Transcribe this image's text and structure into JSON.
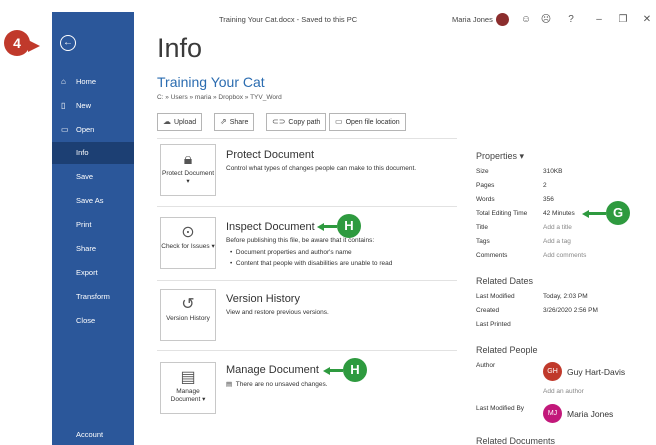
{
  "sidebar": {
    "back_icon": "back-arrow-icon",
    "items": [
      {
        "label": "Home",
        "icon": "home-icon"
      },
      {
        "label": "New",
        "icon": "new-doc-icon"
      },
      {
        "label": "Open",
        "icon": "folder-icon"
      },
      {
        "label": "Info"
      },
      {
        "label": "Save"
      },
      {
        "label": "Save As"
      },
      {
        "label": "Print"
      },
      {
        "label": "Share"
      },
      {
        "label": "Export"
      },
      {
        "label": "Transform"
      },
      {
        "label": "Close"
      },
      {
        "label": "Account"
      }
    ]
  },
  "titlebar": {
    "document": "Training Your Cat.docx  -  Saved to this PC",
    "user": "Maria Jones",
    "icons": {
      "smile": "☺",
      "frown": "☹",
      "help": "?",
      "minimize": "–",
      "restore": "❐",
      "close": "✕"
    }
  },
  "main": {
    "heading": "Info",
    "doc_name": "Training Your Cat",
    "doc_path": "C: » Users » maria » Dropbox » TYV_Word",
    "buttons": [
      "Upload",
      "Share",
      "Copy path",
      "Open file location"
    ],
    "cards": [
      {
        "tile": "Protect Document",
        "title": "Protect Document",
        "desc": "Control what types of changes people can make to this document."
      },
      {
        "tile": "Check for Issues",
        "title": "Inspect Document",
        "desc": "Before publishing this file, be aware that it contains:",
        "bullets": [
          "Document properties and author's name",
          "Content that people with disabilities are unable to read"
        ]
      },
      {
        "tile": "Version History",
        "title": "Version History",
        "desc": "View and restore previous versions."
      },
      {
        "tile": "Manage Document",
        "title": "Manage Document",
        "desc": "There are no unsaved changes."
      }
    ]
  },
  "properties": {
    "heading": "Properties",
    "rows": [
      {
        "k": "Size",
        "v": "310KB"
      },
      {
        "k": "Pages",
        "v": "2"
      },
      {
        "k": "Words",
        "v": "356"
      },
      {
        "k": "Total Editing Time",
        "v": "42 Minutes"
      },
      {
        "k": "Title",
        "v": "Add a title"
      },
      {
        "k": "Tags",
        "v": "Add a tag"
      },
      {
        "k": "Comments",
        "v": "Add comments"
      }
    ],
    "related_dates": {
      "heading": "Related Dates",
      "rows": [
        {
          "k": "Last Modified",
          "v": "Today, 2:03 PM"
        },
        {
          "k": "Created",
          "v": "3/26/2020 2:56 PM"
        },
        {
          "k": "Last Printed",
          "v": ""
        }
      ]
    },
    "related_people": {
      "heading": "Related People",
      "author_label": "Author",
      "author_initials": "GH",
      "author_name": "Guy Hart-Davis",
      "add_author": "Add an author",
      "modified_label": "Last Modified By",
      "modified_initials": "MJ",
      "modified_name": "Maria Jones"
    },
    "related_documents": "Related Documents"
  },
  "callouts": {
    "step": "4",
    "g": "G",
    "h1": "H",
    "h2": "H"
  },
  "colors": {
    "sidebar": "#2b579a",
    "sidebar_active": "#1c3f73",
    "callout_red": "#c0392b",
    "callout_green": "#2e9a3f"
  }
}
